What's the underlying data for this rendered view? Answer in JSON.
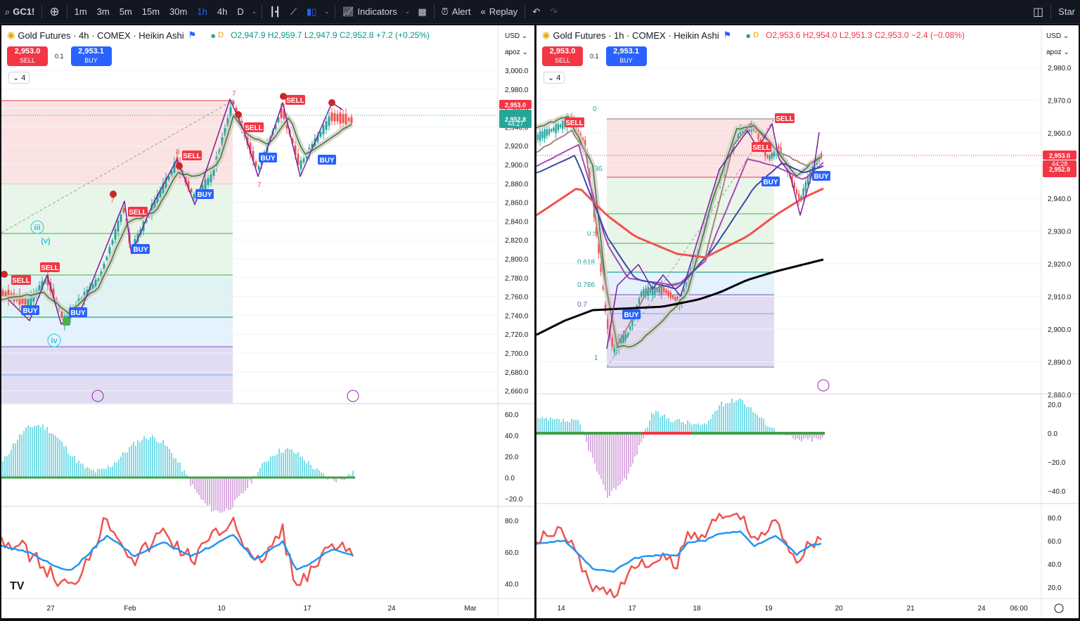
{
  "toolbar": {
    "symbol": "GC1!",
    "intervals": [
      "1m",
      "3m",
      "5m",
      "15m",
      "30m",
      "1h",
      "4h",
      "D"
    ],
    "active_interval": "1h",
    "indicators_label": "Indicators",
    "alert_label": "Alert",
    "replay_label": "Replay",
    "star_label": "Star"
  },
  "left_pane": {
    "title": "Gold Futures · 4h · COMEX · Heikin Ashi",
    "d_badge": "D",
    "ohlc": {
      "o": "O2,947.9",
      "h": "H2,959.7",
      "l": "L2,947.9",
      "c": "C2,952.8",
      "chg": "+7.2 (+0.25%)"
    },
    "sell_price": "2,953.0",
    "sell_label": "SELL",
    "buy_price": "2,953.1",
    "buy_label": "BUY",
    "spread": "0.1",
    "badge": "4",
    "currency": "USD",
    "scale_label": "apoz",
    "price_ticks": [
      "3,000.0",
      "2,980.0",
      "2,960.0",
      "2,940.0",
      "2,920.0",
      "2,900.0",
      "2,880.0",
      "2,860.0",
      "2,840.0",
      "2,820.0",
      "2,800.0",
      "2,780.0",
      "2,760.0",
      "2,740.0",
      "2,720.0",
      "2,700.0",
      "2,680.0",
      "2,660.0"
    ],
    "price_tag": "2,953.0",
    "price_tag2": "2,952.8",
    "countdown": "44:27",
    "osc_ticks": [
      "60.0",
      "40.0",
      "20.0",
      "0.0",
      "−20.0"
    ],
    "rsi_ticks": [
      "80.0",
      "60.0",
      "40.0"
    ],
    "time_ticks": [
      "27",
      "Feb",
      "10",
      "17",
      "24",
      "Mar"
    ],
    "wave_labels": [
      "iii",
      "(v)",
      "iv"
    ],
    "counts": [
      "7",
      "8",
      "7",
      "7",
      "7"
    ],
    "signals": {
      "sell": "SELL",
      "buy": "BUY"
    }
  },
  "right_pane": {
    "title": "Gold Futures · 1h · COMEX · Heikin Ashi",
    "d_badge": "D",
    "ohlc": {
      "o": "O2,953.6",
      "h": "H2,954.0",
      "l": "L2,951.3",
      "c": "C2,953.0",
      "chg": "−2.4 (−0.08%)"
    },
    "sell_price": "2,953.0",
    "sell_label": "SELL",
    "buy_price": "2,953.1",
    "buy_label": "BUY",
    "spread": "0.1",
    "badge": "4",
    "currency": "USD",
    "scale_label": "apoz",
    "price_ticks": [
      "2,980.0",
      "2,970.0",
      "2,960.0",
      "2,950.0",
      "2,940.0",
      "2,930.0",
      "2,920.0",
      "2,910.0",
      "2,900.0",
      "2,890.0",
      "2,880.0"
    ],
    "price_tag": "2,953.0",
    "price_tag2": "2,952.9",
    "countdown": "44:28",
    "fib_labels": [
      "0",
      ".236",
      "0.5",
      "0.618",
      "0.786",
      "0.7",
      "1"
    ],
    "osc_ticks": [
      "20.0",
      "0.0",
      "−20.0",
      "−40.0"
    ],
    "rsi_ticks": [
      "80.0",
      "60.0",
      "40.0",
      "20.0"
    ],
    "time_ticks": [
      "14",
      "17",
      "18",
      "19",
      "20",
      "21",
      "24",
      "06:00"
    ],
    "signals": {
      "sell": "SELL",
      "buy": "BUY"
    }
  },
  "colors": {
    "sell": "#f23645",
    "buy": "#2962ff",
    "up": "#26a69a",
    "down": "#ef5350"
  }
}
